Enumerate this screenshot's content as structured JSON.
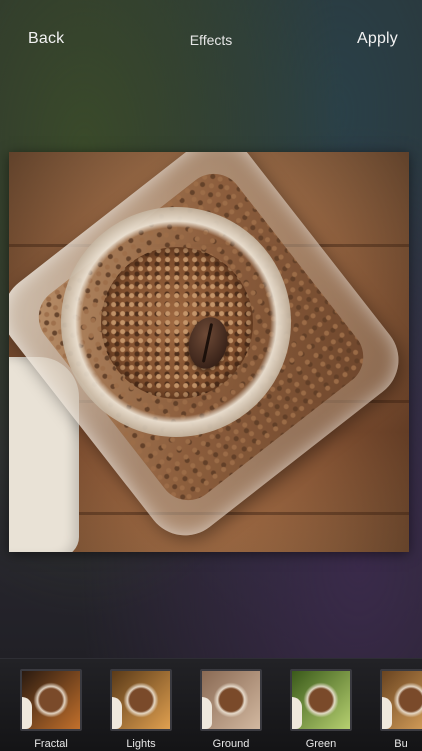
{
  "header": {
    "back_label": "Back",
    "title": "Effects",
    "apply_label": "Apply"
  },
  "filters": [
    {
      "label": "Fractal",
      "colors": [
        "#2a1a10",
        "#c2702c"
      ]
    },
    {
      "label": "Lights",
      "colors": [
        "#5a3a18",
        "#e0a050"
      ]
    },
    {
      "label": "Ground",
      "colors": [
        "#8a6a54",
        "#d2b8a0"
      ]
    },
    {
      "label": "Green",
      "colors": [
        "#3a5a1a",
        "#b6d070"
      ]
    },
    {
      "label": "Bu",
      "colors": [
        "#6a4420",
        "#e0a860"
      ]
    }
  ]
}
